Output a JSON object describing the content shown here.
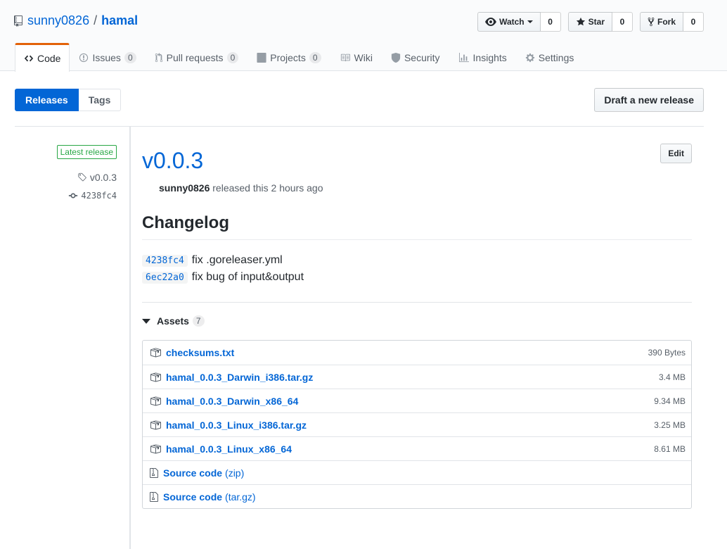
{
  "repo": {
    "owner": "sunny0826",
    "separator": "/",
    "name": "hamal"
  },
  "actions": {
    "watch": {
      "label": "Watch",
      "count": "0"
    },
    "star": {
      "label": "Star",
      "count": "0"
    },
    "fork": {
      "label": "Fork",
      "count": "0"
    }
  },
  "nav": {
    "code": {
      "label": "Code"
    },
    "issues": {
      "label": "Issues",
      "count": "0"
    },
    "pulls": {
      "label": "Pull requests",
      "count": "0"
    },
    "projects": {
      "label": "Projects",
      "count": "0"
    },
    "wiki": {
      "label": "Wiki"
    },
    "security": {
      "label": "Security"
    },
    "insights": {
      "label": "Insights"
    },
    "settings": {
      "label": "Settings"
    }
  },
  "subnav": {
    "releases": "Releases",
    "tags": "Tags",
    "draft": "Draft a new release"
  },
  "meta": {
    "badge": "Latest release",
    "tag": "v0.0.3",
    "commit": "4238fc4"
  },
  "release": {
    "title": "v0.0.3",
    "edit": "Edit",
    "author": "sunny0826",
    "released_text": "released this 2 hours ago",
    "changelog_heading": "Changelog",
    "commits": [
      {
        "sha": "4238fc4",
        "message": "fix .goreleaser.yml"
      },
      {
        "sha": "6ec22a0",
        "message": "fix bug of input&output"
      }
    ]
  },
  "assets": {
    "label": "Assets",
    "count": "7",
    "files": [
      {
        "name": "checksums.txt",
        "size": "390 Bytes"
      },
      {
        "name": "hamal_0.0.3_Darwin_i386.tar.gz",
        "size": "3.4 MB"
      },
      {
        "name": "hamal_0.0.3_Darwin_x86_64",
        "size": "9.34 MB"
      },
      {
        "name": "hamal_0.0.3_Linux_i386.tar.gz",
        "size": "3.25 MB"
      },
      {
        "name": "hamal_0.0.3_Linux_x86_64",
        "size": "8.61 MB"
      }
    ],
    "source": [
      {
        "name": "Source code",
        "ext": "(zip)"
      },
      {
        "name": "Source code",
        "ext": "(tar.gz)"
      }
    ]
  },
  "colors": {
    "link": "#0366d6",
    "nav_accent": "#e36209",
    "release_badge": "#28a745"
  }
}
